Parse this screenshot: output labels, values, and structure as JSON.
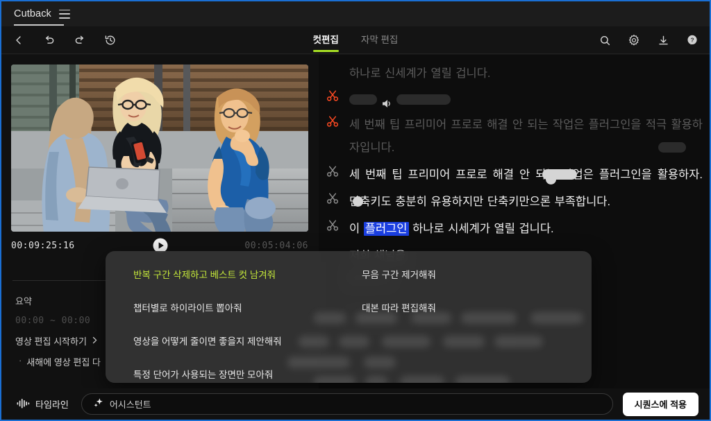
{
  "window": {
    "app_title": "Cutback",
    "menu_icon": "hamburger-icon"
  },
  "toolbar": {
    "back_icon": "chevron-left-icon",
    "undo_icon": "undo-icon",
    "redo_icon": "redo-icon",
    "history_icon": "history-icon",
    "search_icon": "search-icon",
    "settings_icon": "gear-icon",
    "download_icon": "download-icon",
    "help_icon": "help-icon",
    "accent_color": "#a8e024"
  },
  "tabs": [
    {
      "label": "컷편집",
      "active": true
    },
    {
      "label": "자막 편집",
      "active": false
    }
  ],
  "player": {
    "current_timecode": "00:09:25:16",
    "total_timecode": "00:05:04:06",
    "play_icon": "play-icon"
  },
  "summary": {
    "title": "요약",
    "range": "00:00 ~ 00:00",
    "start_link": "영상 편집 시작하기",
    "chevron_icon": "chevron-right-icon",
    "bullet": "새해에 영상 편집 다"
  },
  "transcript": {
    "lines": [
      {
        "cut_icon": "scissors-icon",
        "cut_color": "#ff4a22",
        "state": "dim",
        "text": "하나로  신세계가  열릴  겁니다."
      },
      {
        "cut_icon": "scissors-icon",
        "cut_color": "#ff4a22",
        "state": "pills",
        "text": ""
      },
      {
        "cut_icon": "scissors-icon",
        "cut_color": "#ff4a22",
        "state": "dim",
        "text": "세  번째  팁  프리미어  프로로  해결  안  되는  작업은  플러그인을  적극  활용하자입니다."
      },
      {
        "cut_icon": "scissors-icon",
        "cut_color": "#8c8c8c",
        "state": "normal",
        "text": "세  번째  팁  프리미어  프로로  해결  안  되는  작업은  플러그인을  활용하자."
      },
      {
        "cut_icon": "scissors-icon",
        "cut_color": "#8c8c8c",
        "state": "normal",
        "text": "단축키도  충분히  유용하지만  단축키만으론  부족합니다."
      },
      {
        "cut_icon": "scissors-icon",
        "cut_color": "#8c8c8c",
        "state": "selected",
        "prefix": "이 ",
        "selected_word": "플러그인",
        "suffix": " 하나로  시세계가  열릴  겁니다."
      },
      {
        "cut_icon": "scissors-icon",
        "cut_color": "#8c8c8c",
        "state": "normal",
        "text_right_a": "저희  채널을",
        "text_right_b": "한  번  더"
      },
      {
        "cut_icon": "scissors-icon",
        "cut_color": "#8c8c8c",
        "state": "dim",
        "text_right_c": "처리해  주는"
      }
    ],
    "selection_color": "#1b3fe0"
  },
  "suggestions": {
    "items": [
      {
        "label": "반복 구간 삭제하고 베스트 컷 남겨줘",
        "highlight": true
      },
      {
        "label": "무음 구간 제거해줘",
        "highlight": false
      },
      {
        "label": "챕터별로 하이라이트 뽑아줘",
        "highlight": false
      },
      {
        "label": "대본 따라 편집해줘",
        "highlight": false
      },
      {
        "label": "영상을 어떻게 줄이면 좋을지 제안해줘",
        "highlight": false
      },
      {
        "label": "",
        "highlight": false
      },
      {
        "label": "특정 단어가 사용되는 장면만 모아줘",
        "highlight": false
      },
      {
        "label": "",
        "highlight": false
      }
    ],
    "highlight_color": "#c5e83a"
  },
  "bottom": {
    "timeline_label": "타임라인",
    "timeline_icon": "waveform-icon",
    "assistant_placeholder": "어시스턴트",
    "assistant_icon": "sparkle-icon",
    "apply_label": "시퀀스에 적용"
  }
}
